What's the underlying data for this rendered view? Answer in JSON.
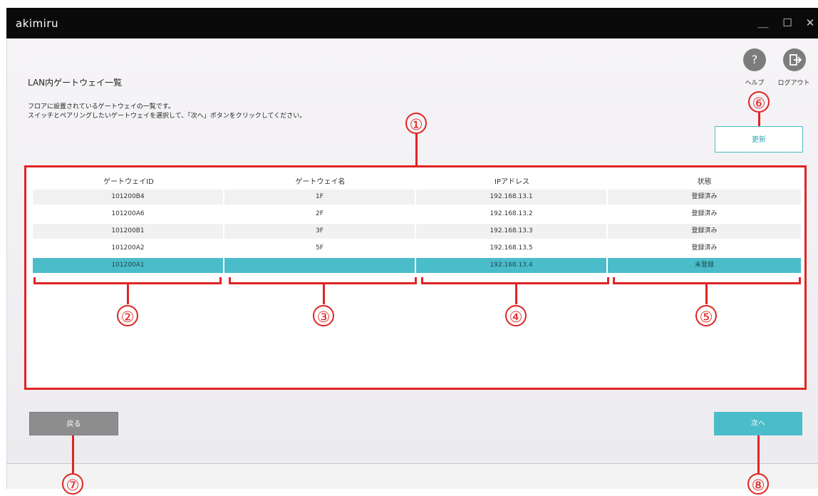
{
  "app": {
    "title": "akimiru"
  },
  "window_controls": {
    "minimize": "＿",
    "maximize": "☐",
    "close": "✕"
  },
  "header": {
    "help_label": "ヘルプ",
    "logout_label": "ログアウト"
  },
  "page": {
    "title": "LAN内ゲートウェイ一覧",
    "desc_line1": "フロアに設置されているゲートウェイの一覧です。",
    "desc_line2": "スイッチとペアリングしたいゲートウェイを選択して、「次へ」ボタンをクリックしてください。"
  },
  "buttons": {
    "refresh": "更新",
    "back": "戻る",
    "next": "次へ"
  },
  "table": {
    "headers": [
      "ゲートウェイID",
      "ゲートウェイ名",
      "IPアドレス",
      "状態"
    ],
    "rows": [
      [
        "101200B4",
        "1F",
        "192.168.13.1",
        "登録済み"
      ],
      [
        "101200A6",
        "2F",
        "192.168.13.2",
        "登録済み"
      ],
      [
        "101200B1",
        "3F",
        "192.168.13.3",
        "登録済み"
      ],
      [
        "101200A2",
        "5F",
        "192.168.13.5",
        "登録済み"
      ],
      [
        "101200A1",
        "",
        "192.168.13.4",
        "未登録"
      ]
    ],
    "selected_row": 4
  },
  "callouts": [
    "①",
    "②",
    "③",
    "④",
    "⑤",
    "⑥",
    "⑦",
    "⑧"
  ],
  "colors": {
    "accent": "#4bbcc9",
    "annotation": "#e02424",
    "titlebar": "#0a0a0a"
  }
}
